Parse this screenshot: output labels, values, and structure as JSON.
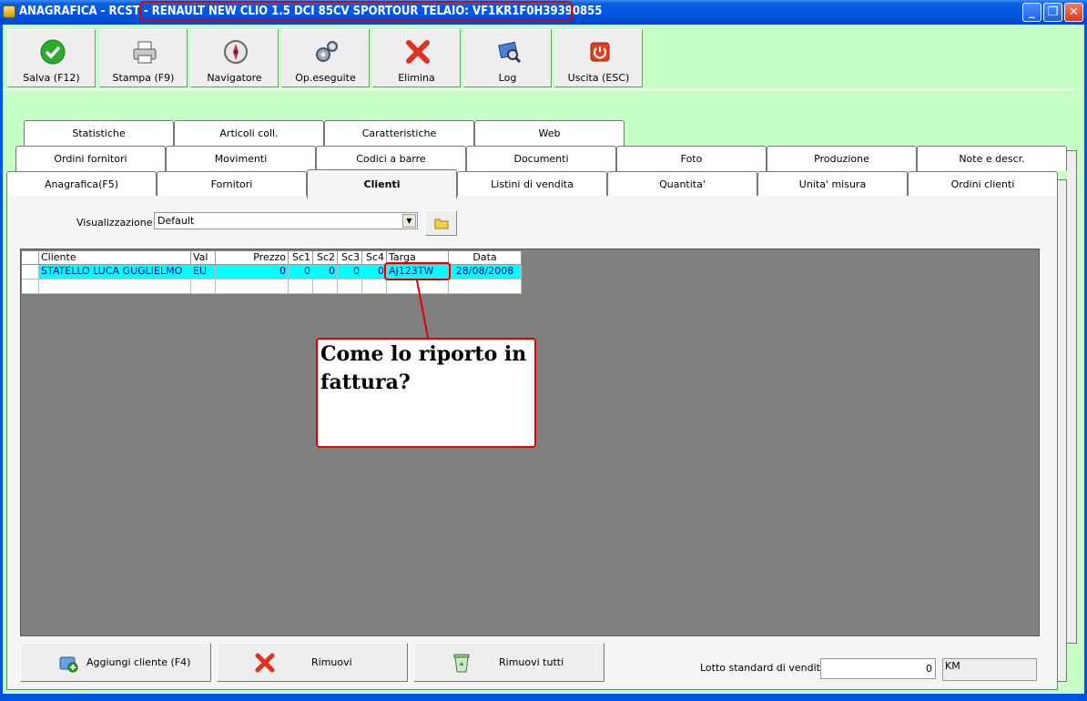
{
  "window": {
    "title_prefix": "ANAGRAFICA - RCST - ",
    "title_highlight": "RENAULT NEW CLIO 1.5 DCI 85CV SPORTOUR TELAIO: VF1KR1F0H39390855"
  },
  "toolbar": [
    {
      "label": "Salva (F12)",
      "icon": "checkmark-icon"
    },
    {
      "label": "Stampa (F9)",
      "icon": "printer-icon"
    },
    {
      "label": "Navigatore",
      "icon": "compass-icon"
    },
    {
      "label": "Op.eseguite",
      "icon": "gears-icon"
    },
    {
      "label": "Elimina",
      "icon": "red-x-icon"
    },
    {
      "label": "Log",
      "icon": "log-search-icon"
    },
    {
      "label": "Uscita (ESC)",
      "icon": "power-icon"
    }
  ],
  "tabs": {
    "row1": [
      "Statistiche",
      "Articoli coll.",
      "Caratteristiche",
      "Web"
    ],
    "row2": [
      "Ordini fornitori",
      "Movimenti",
      "Codici a barre",
      "Documenti",
      "Foto",
      "Produzione",
      "Note e descr."
    ],
    "row3": [
      "Anagrafica(F5)",
      "Fornitori",
      "Clienti",
      "Listini di vendita",
      "Quantita'",
      "Unita' misura",
      "Ordini clienti"
    ],
    "active": "Clienti"
  },
  "view": {
    "label": "Visualizzazione :",
    "value": "Default"
  },
  "table": {
    "columns": [
      "Cliente",
      "Val",
      "Prezzo",
      "Sc1",
      "Sc2",
      "Sc3",
      "Sc4",
      "Targa",
      "Data"
    ],
    "rows": [
      [
        "STATELLO LUCA GUGLIELMO",
        "EU",
        "0",
        "0",
        "0",
        "0",
        "0",
        "AJ123TW",
        "28/08/2008"
      ]
    ]
  },
  "callout": {
    "text": "Come lo riporto in fattura?",
    "color": "#e00000"
  },
  "bottom": {
    "add_label": "Aggiungi cliente (F4)",
    "remove_label": "Rimuovi",
    "remove_all_label": "Rimuovi tutti",
    "lotto_label": "Lotto standard di vendita :",
    "lotto_value": "0",
    "unit": "KM"
  },
  "colors": {
    "background": "#c5ffc5",
    "selected_row": "#00ffff",
    "title_bar": "#0054e3",
    "grid": "#808080"
  }
}
